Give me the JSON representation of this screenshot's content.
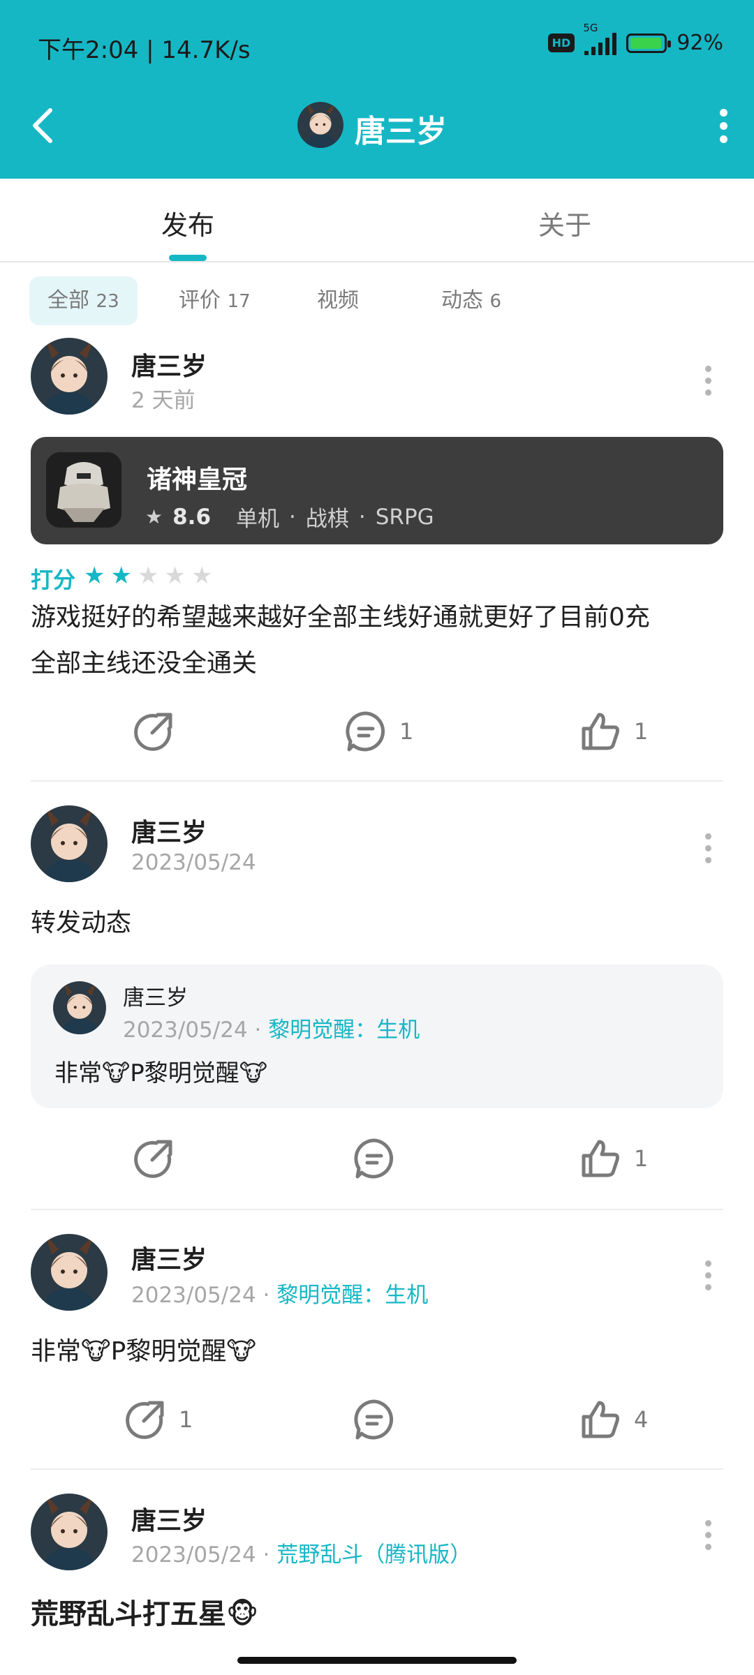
{
  "status": {
    "time": "下午2:04 | 14.7K/s",
    "hd": "HD",
    "net": "5G",
    "battery": "92%"
  },
  "header": {
    "title": "唐三岁"
  },
  "tabs": {
    "publish": "发布",
    "about": "关于"
  },
  "filters": [
    {
      "label": "全部",
      "count": "23"
    },
    {
      "label": "评价",
      "count": "17"
    },
    {
      "label": "视频",
      "count": ""
    },
    {
      "label": "动态",
      "count": "6"
    }
  ],
  "posts": [
    {
      "user": "唐三岁",
      "time": "2 天前",
      "game": {
        "name": "诸神皇冠",
        "score": "8.6",
        "tags": [
          "单机",
          "战棋",
          "SRPG"
        ]
      },
      "rating_label": "打分",
      "rating": 2,
      "rating_max": 5,
      "text_line1": "游戏挺好的希望越来越好全部主线好通就更好了目前0充",
      "text_line2": "全部主线还没全通关",
      "comments": "1",
      "likes": "1"
    },
    {
      "user": "唐三岁",
      "time": "2023/05/24",
      "text": "转发动态",
      "repost": {
        "user": "唐三岁",
        "time": "2023/05/24",
        "game": "黎明觉醒：生机",
        "text": "非常🐮P黎明觉醒🐮"
      },
      "likes": "1"
    },
    {
      "user": "唐三岁",
      "time": "2023/05/24",
      "game": "黎明觉醒：生机",
      "text": "非常🐮P黎明觉醒🐮",
      "shares": "1",
      "likes": "4"
    },
    {
      "user": "唐三岁",
      "time": "2023/05/24",
      "game": "荒野乱斗（腾讯版）",
      "text": "荒野乱斗打五星🐵"
    }
  ],
  "colors": {
    "accent": "#16b7c5",
    "header_bg": "#16b7c5",
    "card_bg": "#3d3d3d"
  }
}
